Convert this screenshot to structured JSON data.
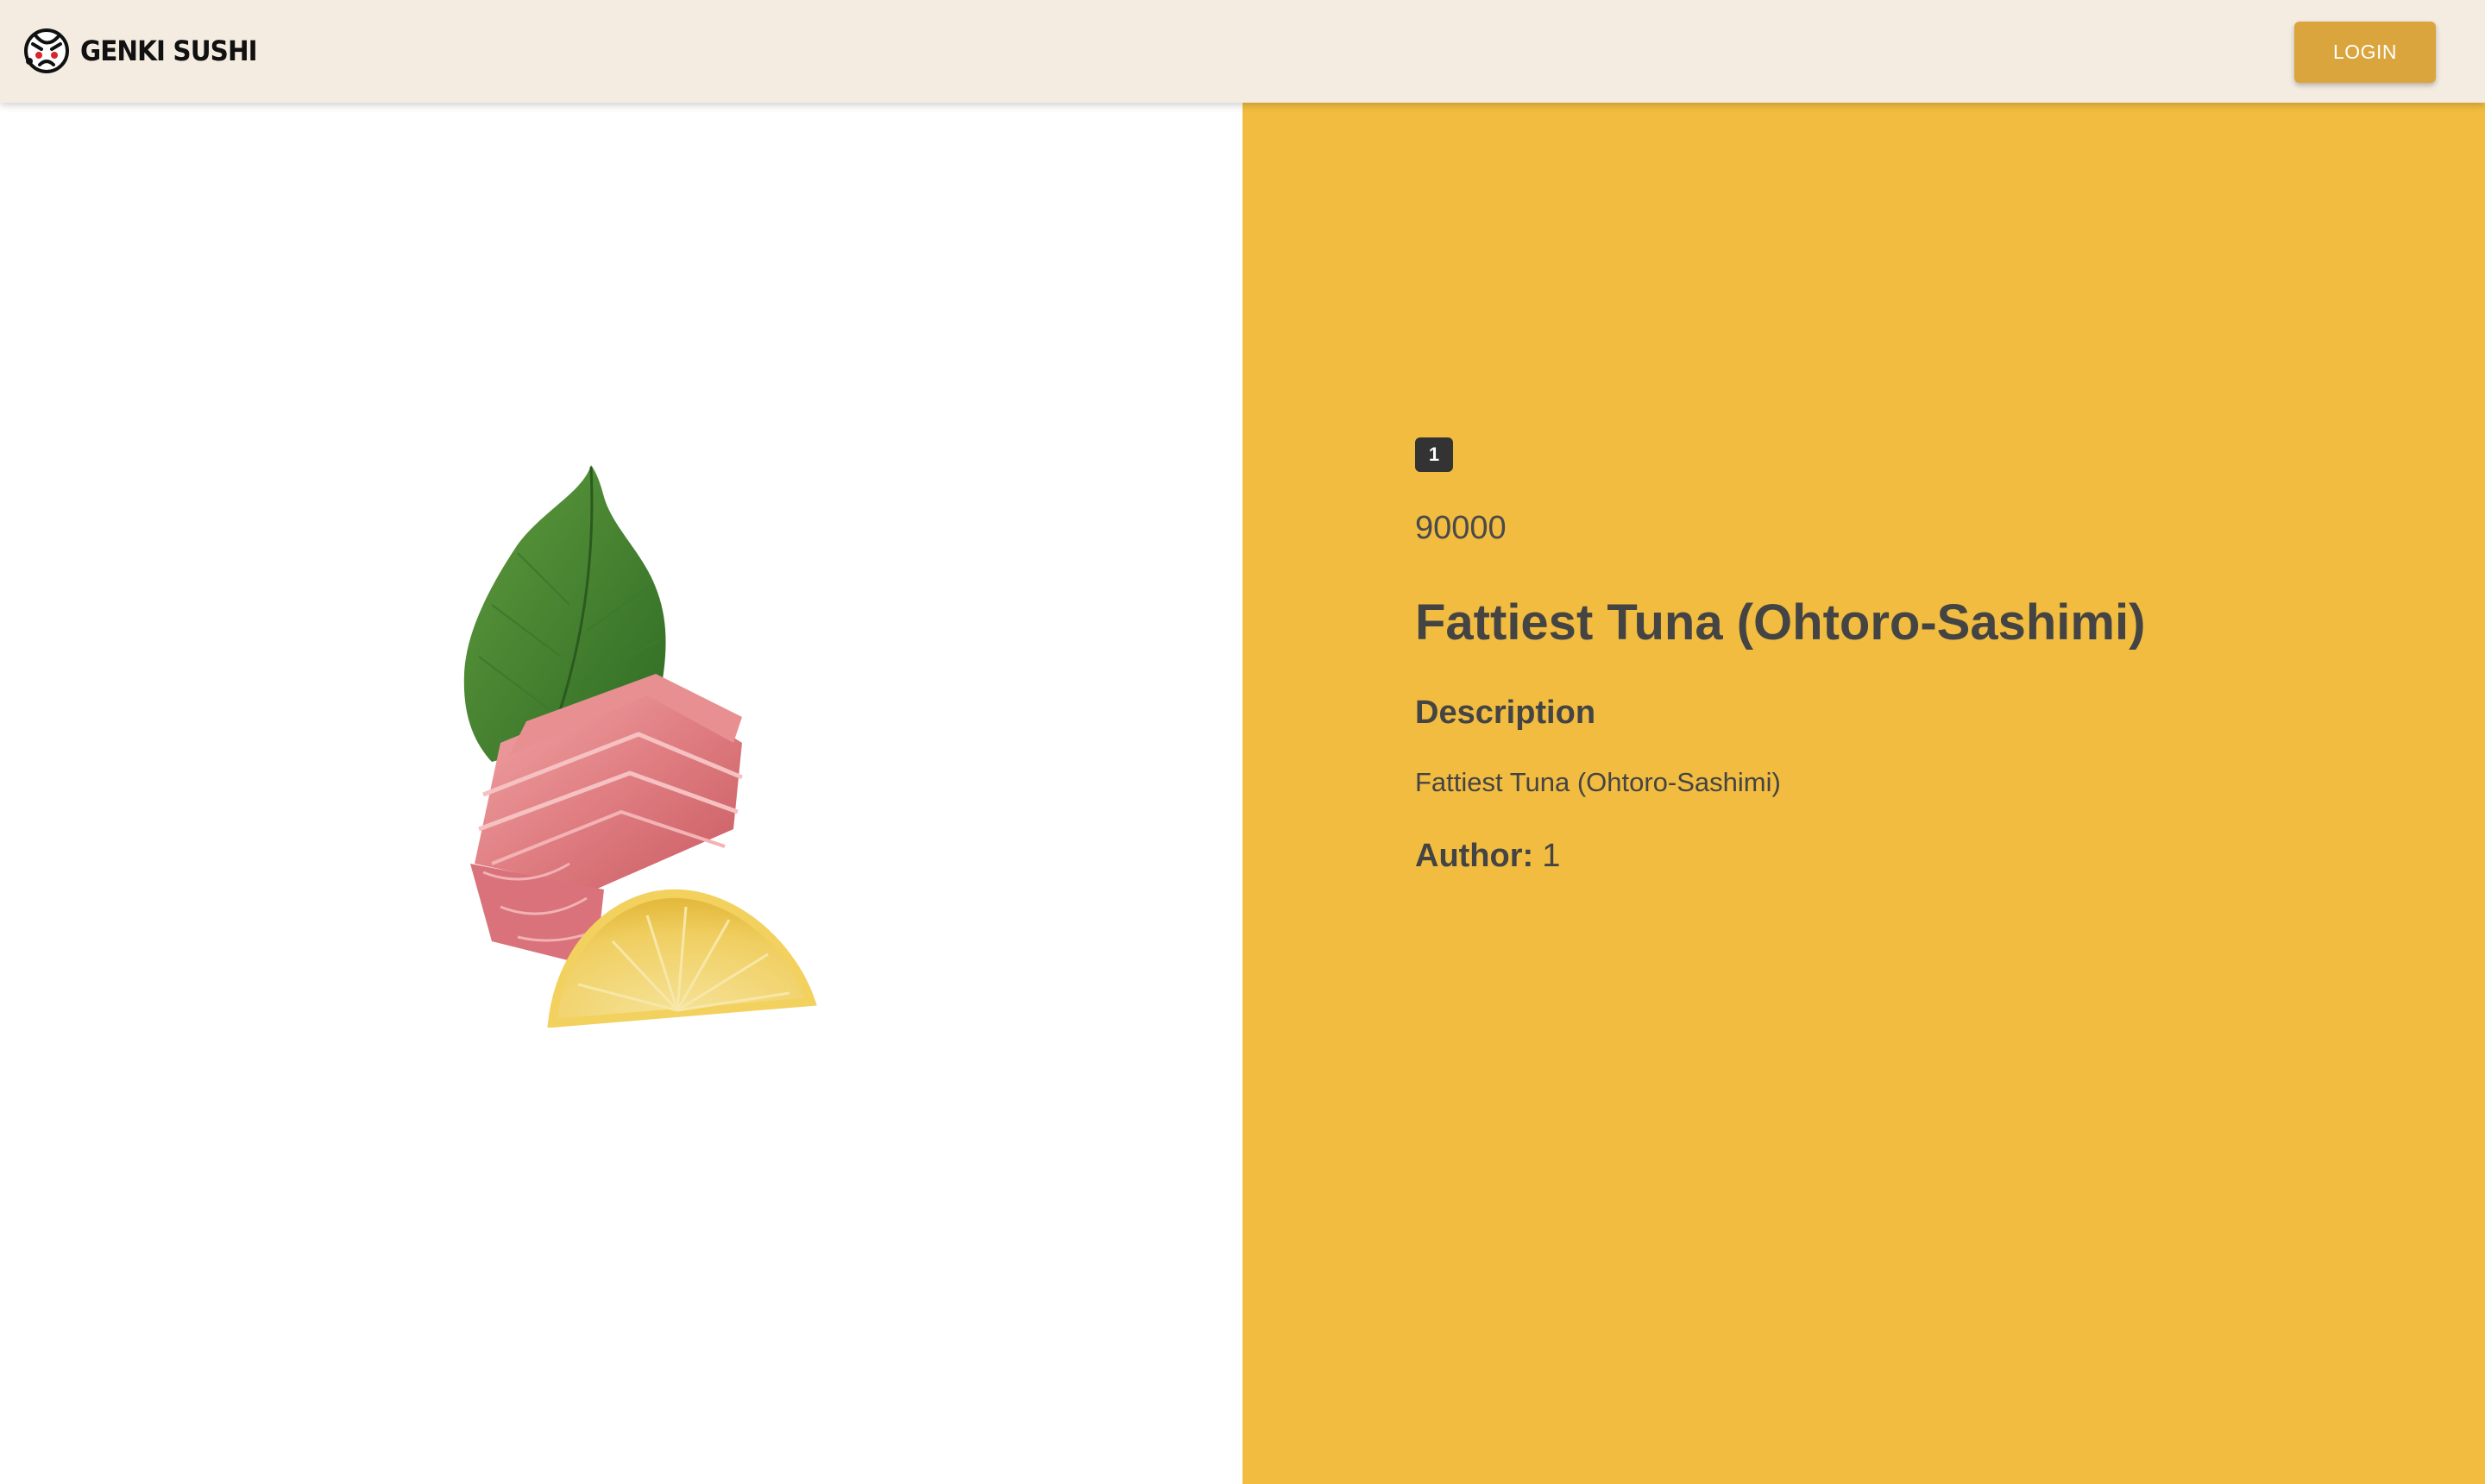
{
  "header": {
    "brand_name": "GENKI SUSHI",
    "logo_icon": "genki-sushi-face-logo",
    "login_label": "LOGIN",
    "background": "#f4ece1",
    "button_color": "#dba53d"
  },
  "product": {
    "id_badge": "1",
    "price": "90000",
    "title": "Fattiest Tuna (Ohtoro-Sashimi)",
    "description_heading": "Description",
    "description": "Fattiest Tuna (Ohtoro-Sashimi)",
    "author_label": "Author:",
    "author_value": "1",
    "image": "ohtoro-sashimi-photo",
    "panel_color": "#f1bc3f"
  }
}
